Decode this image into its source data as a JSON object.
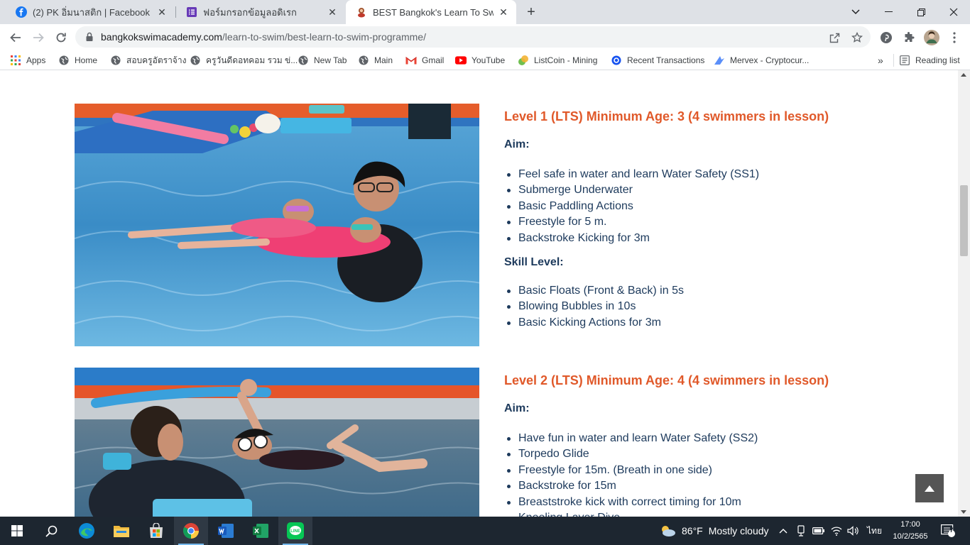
{
  "browser": {
    "tabs": [
      {
        "title": "(2) PK อิ่มนาสติก | Facebook",
        "icon": "facebook-icon"
      },
      {
        "title": "ฟอร์มกรอกข้อมูลอดิเรก",
        "icon": "forms-icon"
      },
      {
        "title": "BEST Bangkok's Learn To Swim Pr",
        "icon": "site-favicon"
      }
    ],
    "url_domain": "bangkokswimacademy.com",
    "url_path": "/learn-to-swim/best-learn-to-swim-programme/",
    "bookmarks": [
      {
        "label": "Apps",
        "icon": "apps-grid-icon"
      },
      {
        "label": "Home",
        "icon": "globe-icon"
      },
      {
        "label": "สอบครูอัตราจ้าง",
        "icon": "globe-icon"
      },
      {
        "label": "ครูวันดีดอทคอม รวม ข่...",
        "icon": "globe-icon"
      },
      {
        "label": "New Tab",
        "icon": "globe-icon"
      },
      {
        "label": "Main",
        "icon": "globe-icon"
      },
      {
        "label": "Gmail",
        "icon": "gmail-icon"
      },
      {
        "label": "YouTube",
        "icon": "youtube-icon"
      },
      {
        "label": "ListCoin - Mining",
        "icon": "listcoin-icon"
      },
      {
        "label": "Recent Transactions",
        "icon": "coinbase-icon"
      },
      {
        "label": "Mervex - Cryptocur...",
        "icon": "mervex-icon"
      }
    ],
    "reading_list": "Reading list"
  },
  "levels": [
    {
      "title": "Level 1 (LTS) Minimum Age: 3 (4 swimmers in lesson)",
      "aim_label": "Aim:",
      "aims": [
        "Feel safe in water and learn Water Safety (SS1)",
        "Submerge Underwater",
        "Basic Paddling Actions",
        "Freestyle for 5 m.",
        "Backstroke Kicking for 3m"
      ],
      "skill_label": "Skill Level:",
      "skills": [
        "Basic Floats (Front & Back) in 5s",
        "Blowing Bubbles in 10s",
        "Basic Kicking Actions for 3m"
      ]
    },
    {
      "title": "Level 2 (LTS) Minimum Age: 4 (4 swimmers in lesson)",
      "aim_label": "Aim:",
      "aims": [
        "Have fun in water and learn Water Safety (SS2)",
        "Torpedo Glide",
        "Freestyle for 15m. (Breath in one side)",
        "Backstroke for 15m",
        "Breaststroke kick with correct timing for 10m",
        "Kneeling Layer Dive"
      ]
    }
  ],
  "taskbar": {
    "weather_temp": "86°F",
    "weather_desc": "Mostly cloudy",
    "language": "ไทย",
    "time": "17:00",
    "date": "10/2/2565",
    "notifications": "7"
  },
  "colors": {
    "accent_heading": "#e0592a",
    "body_text": "#1d3a5c",
    "tabstrip_bg": "#dee1e6",
    "taskbar_bg": "#1d2630"
  }
}
